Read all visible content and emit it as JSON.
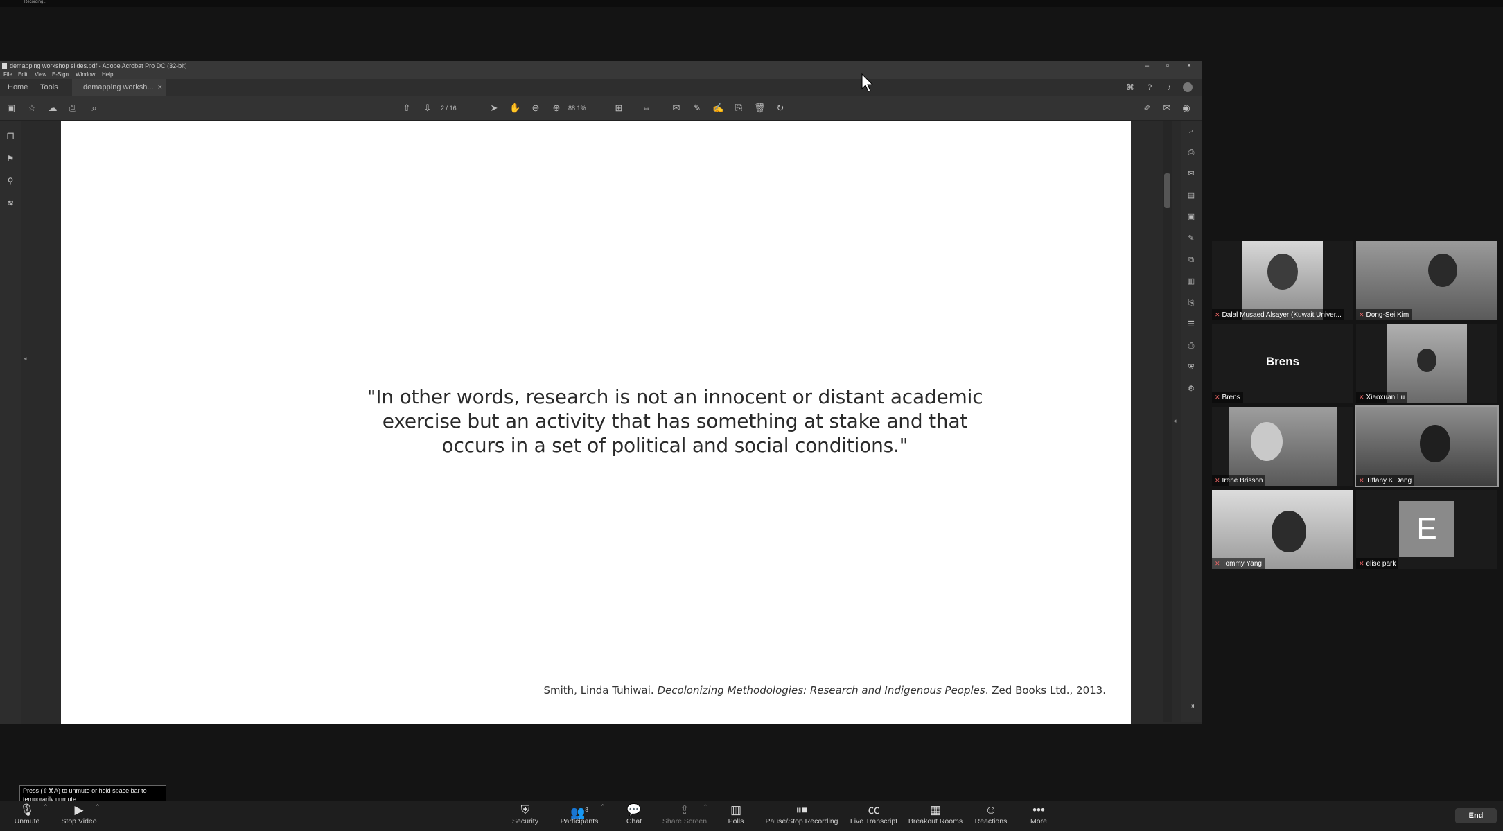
{
  "topstrip": {
    "recording_label": "Recording..."
  },
  "window": {
    "title": "demapping workshop slides.pdf - Adobe Acrobat Pro DC (32-bit)",
    "minimize": "–",
    "maximize": "▫",
    "close": "×"
  },
  "menu": [
    "File",
    "Edit",
    "View",
    "E-Sign",
    "Window",
    "Help"
  ],
  "tabs": {
    "home": "Home",
    "tools": "Tools",
    "document": "demapping worksh...",
    "close": "×"
  },
  "toolbar": {
    "page_current": "2",
    "page_separator": "/",
    "page_total": "16",
    "zoom": "88.1%"
  },
  "slide": {
    "quote_line1": "\"In other words, research is not an innocent or distant academic",
    "quote_line2": "exercise but an activity that has something at stake and that",
    "quote_line3": "occurs in a set of political and social conditions.\"",
    "citation_prefix": "Smith, Linda Tuhiwai. ",
    "citation_title": "Decolonizing Methodologies: Research and Indigenous Peoples",
    "citation_suffix": ". Zed Books Ltd., 2013."
  },
  "participants": [
    {
      "name": "Dalal Musaed Alsayer (Kuwait Univer...",
      "video": true
    },
    {
      "name": "Dong-Sei Kim",
      "video": true
    },
    {
      "name": "Brens",
      "video": false,
      "display_name": "Brens"
    },
    {
      "name": "Xiaoxuan Lu",
      "video": true
    },
    {
      "name": "Irene Brisson",
      "video": true
    },
    {
      "name": "Tiffany K Dang",
      "video": true,
      "active_speaker": true
    },
    {
      "name": "Tommy Yang",
      "video": true
    },
    {
      "name": "elise park",
      "video": false,
      "initial": "E"
    }
  ],
  "zoom_toolbar": {
    "unmute": "Unmute",
    "stop_video": "Stop Video",
    "security": "Security",
    "participants": "Participants",
    "participants_count": "8",
    "chat": "Chat",
    "share_screen": "Share Screen",
    "polls": "Polls",
    "recording": "Pause/Stop Recording",
    "live_transcript": "Live Transcript",
    "breakout_rooms": "Breakout Rooms",
    "reactions": "Reactions",
    "more": "More",
    "end": "End"
  },
  "tooltip": {
    "line1": "Press (⇧⌘A) to unmute or hold space bar to",
    "line2": "temporarily unmute."
  },
  "colors": {
    "background": "#141414",
    "page": "#ffffff",
    "acrobat_chrome": "#333333",
    "active_speaker_border": "#9a9a9a"
  }
}
